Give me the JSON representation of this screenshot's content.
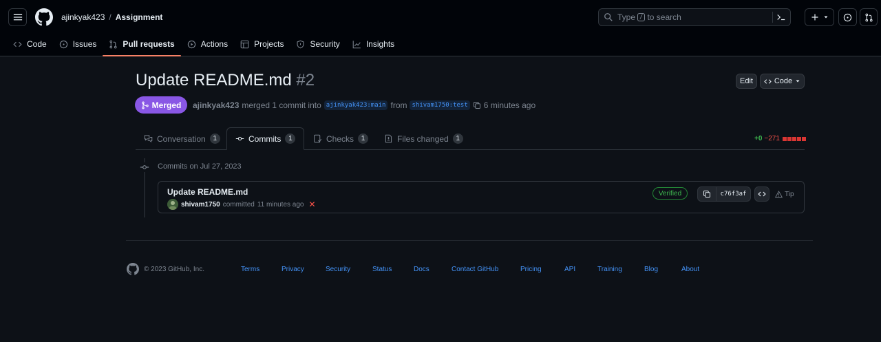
{
  "header": {
    "owner": "ajinkyak423",
    "separator": "/",
    "repo": "Assignment",
    "search_prefix": "Type",
    "search_key": "/",
    "search_suffix": "to search"
  },
  "nav": {
    "items": [
      {
        "label": "Code",
        "icon": "code-icon"
      },
      {
        "label": "Issues",
        "icon": "issue-opened-icon"
      },
      {
        "label": "Pull requests",
        "icon": "git-pull-request-icon",
        "active": true
      },
      {
        "label": "Actions",
        "icon": "play-icon"
      },
      {
        "label": "Projects",
        "icon": "table-icon"
      },
      {
        "label": "Security",
        "icon": "shield-icon"
      },
      {
        "label": "Insights",
        "icon": "graph-icon"
      }
    ]
  },
  "pr": {
    "title": "Update README.md",
    "number": "#2",
    "edit_label": "Edit",
    "code_label": "Code",
    "state": "Merged",
    "author": "ajinkyak423",
    "merge_text": "merged 1 commit into",
    "base_branch": "ajinkyak423:main",
    "from_text": "from",
    "head_branch": "shivam1750:test",
    "time": "6 minutes ago"
  },
  "tabs": [
    {
      "label": "Conversation",
      "count": "1"
    },
    {
      "label": "Commits",
      "count": "1",
      "active": true
    },
    {
      "label": "Checks",
      "count": "1"
    },
    {
      "label": "Files changed",
      "count": "1"
    }
  ],
  "diffstat": {
    "additions": "+0",
    "deletions": "−271"
  },
  "timeline": {
    "date_heading": "Commits on Jul 27, 2023",
    "commit": {
      "message": "Update README.md",
      "author": "shivam1750",
      "action": "committed",
      "time": "11 minutes ago",
      "verified": "Verified",
      "sha": "c76f3af",
      "tip": "Tip"
    }
  },
  "footer": {
    "copyright": "© 2023 GitHub, Inc.",
    "links": [
      "Terms",
      "Privacy",
      "Security",
      "Status",
      "Docs",
      "Contact GitHub",
      "Pricing",
      "API",
      "Training",
      "Blog",
      "About"
    ]
  },
  "colors": {
    "background": "#0d1117",
    "header_bg": "#010409",
    "merged": "#8957e5",
    "link": "#4493f8",
    "added": "#3fb950",
    "deleted": "#f85149",
    "nav_underline": "#f78166"
  }
}
